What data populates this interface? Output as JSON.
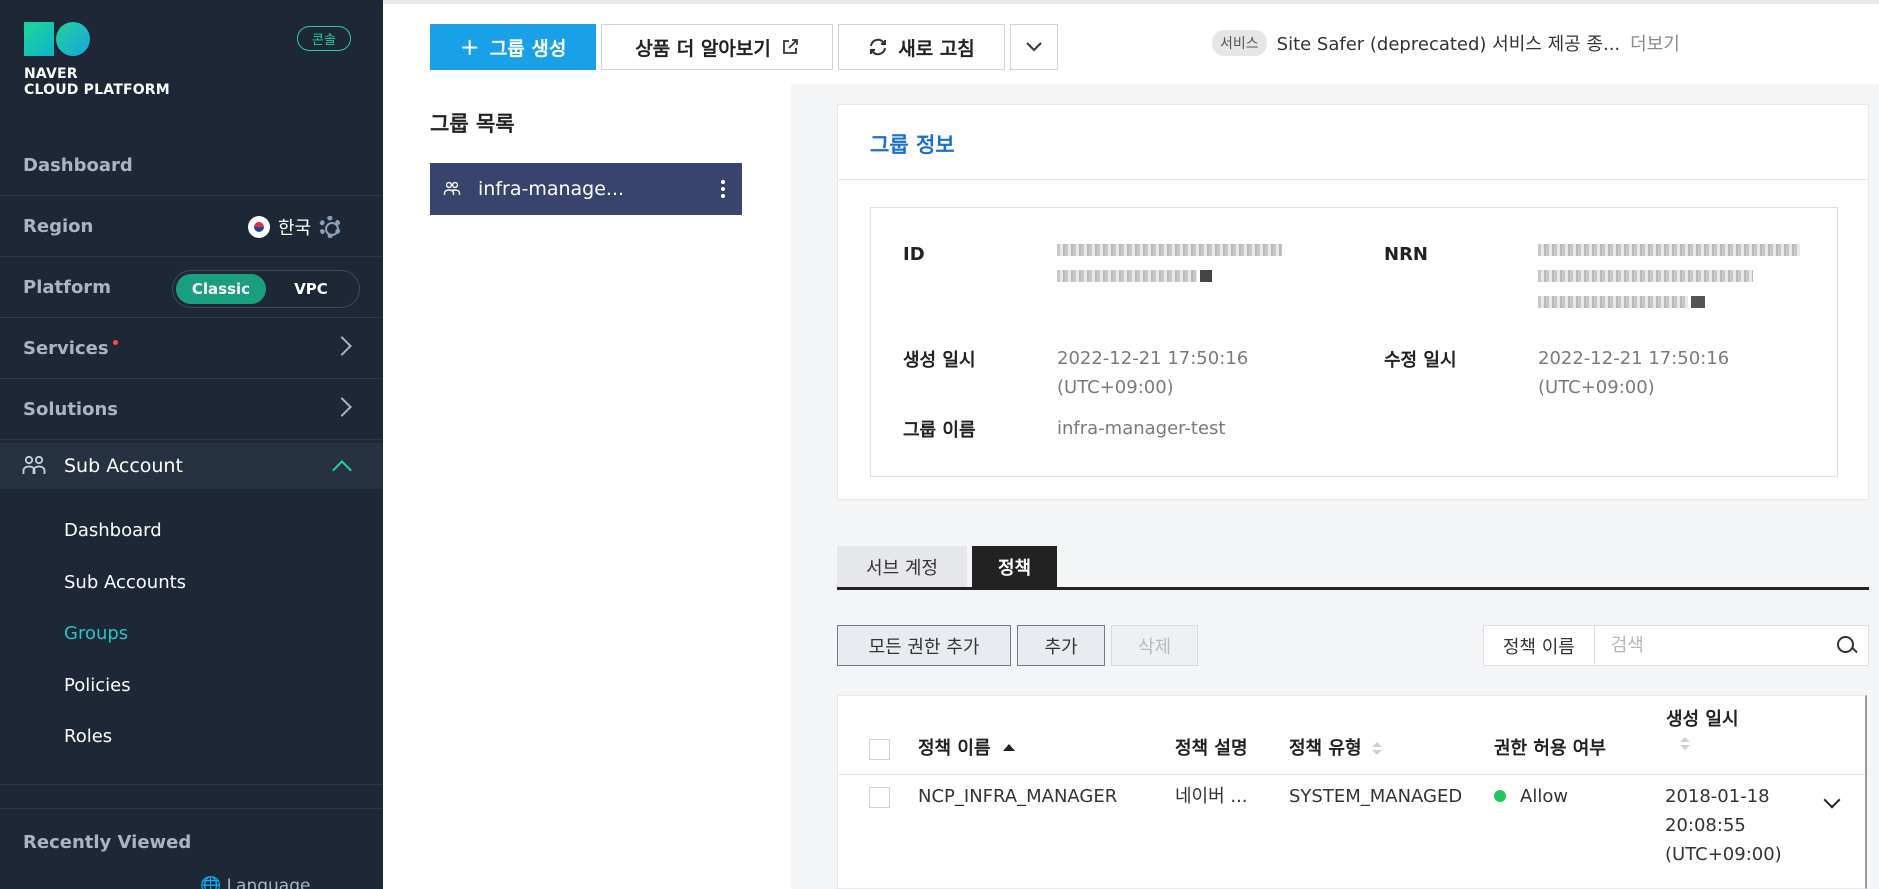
{
  "sidebar": {
    "logo_line1": "NAVER",
    "logo_line2": "CLOUD PLATFORM",
    "console_badge": "콘솔",
    "dashboard": "Dashboard",
    "region_label": "Region",
    "region_value": "한국",
    "platform_label": "Platform",
    "platform_options": [
      "Classic",
      "VPC"
    ],
    "platform_selected": "Classic",
    "services": "Services",
    "solutions": "Solutions",
    "sub_account": "Sub Account",
    "sub_items": [
      "Dashboard",
      "Sub Accounts",
      "Groups",
      "Policies",
      "Roles"
    ],
    "active_sub_item": "Groups",
    "recently_viewed": "Recently Viewed",
    "language": "Language"
  },
  "toolbar": {
    "create_group": "그룹 생성",
    "learn_more": "상품 더 알아보기",
    "refresh": "새로 고침",
    "notice_tag": "서비스",
    "notice_text": "Site Safer (deprecated) 서비스 제공 종...",
    "notice_more": "더보기"
  },
  "group_list": {
    "title": "그룹 목록",
    "items": [
      {
        "name": "infra-manage..."
      }
    ]
  },
  "group_info": {
    "title": "그룹 정보",
    "id_label": "ID",
    "nrn_label": "NRN",
    "created_label": "생성 일시",
    "created_date": "2022-12-21 17:50:16",
    "created_tz": "(UTC+09:00)",
    "modified_label": "수정 일시",
    "modified_date": "2022-12-21 17:50:16",
    "modified_tz": "(UTC+09:00)",
    "name_label": "그룹 이름",
    "name_value": "infra-manager-test"
  },
  "tabs": {
    "sub_account": "서브 계정",
    "policy": "정책"
  },
  "actions": {
    "add_all": "모든 권한 추가",
    "add": "추가",
    "delete": "삭제"
  },
  "search": {
    "field": "정책 이름",
    "placeholder": "검색"
  },
  "policy_table": {
    "headers": {
      "name": "정책 이름",
      "desc": "정책 설명",
      "type": "정책 유형",
      "allow": "권한 허용 여부",
      "created": "생성 일시"
    },
    "rows": [
      {
        "name": "NCP_INFRA_MANAGER",
        "desc": "네이버 ...",
        "type": "SYSTEM_MANAGED",
        "allow": "Allow",
        "created_date": "2018-01-18",
        "created_time": "20:08:55",
        "created_tz": "(UTC+09:00)"
      }
    ]
  },
  "colors": {
    "primary": "#1aa0e6",
    "sidebar_bg": "#1e2736",
    "accent_green": "#1fd49a",
    "active_link": "#29c4c4",
    "selected_group": "#38446b",
    "allow_dot": "#22c55e"
  }
}
